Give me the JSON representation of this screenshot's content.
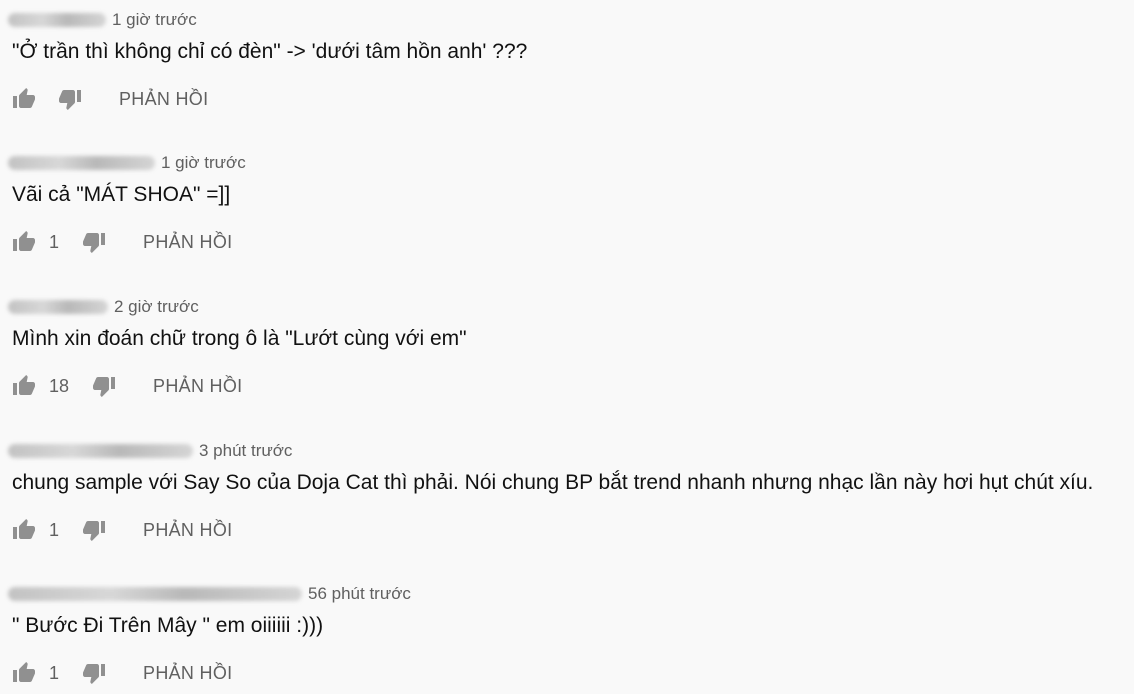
{
  "comments": [
    {
      "author_blurred": "Nhiem Tri",
      "time": "1 giờ trước",
      "text": "\"Ở trần thì không chỉ có đèn\" -> 'dưới tâm hồn anh' ???",
      "likes": "",
      "reply_label": "PHẢN HỒI"
    },
    {
      "author_blurred": "cô gái Đông Lào",
      "time": "1 giờ trước",
      "text": "Vãi cả \"MÁT SHOA\" =]]",
      "likes": "1",
      "reply_label": "PHẢN HỒI"
    },
    {
      "author_blurred": "Breaker Bt",
      "time": "2 giờ trước",
      "text": "Mình xin đoán chữ trong ô là \"Lướt cùng với em\"",
      "likes": "18",
      "reply_label": "PHẢN HỒI"
    },
    {
      "author_blurred": "Ngô Nguyễn Vũ Trâm",
      "time": "3 phút trước",
      "text": "chung sample với Say So của Doja Cat thì phải. Nói chung BP bắt trend nhanh nhưng nhạc lần này hơi hụt chút xíu.",
      "likes": "1",
      "reply_label": "PHẢN HỒI"
    },
    {
      "author_blurred": "Le Van Dinh Minh FPL HN K15",
      "time": "56 phút trước",
      "text": "\" Bước Đi Trên Mây \" em oiiiiii :)))",
      "likes": "1",
      "reply_label": "PHẢN HỒI"
    }
  ],
  "icons": {
    "like": "thumb-up-icon",
    "dislike": "thumb-down-icon"
  },
  "colors": {
    "background": "#f9f9f9",
    "icon": "#909090",
    "meta": "#606060",
    "text": "#111111"
  }
}
